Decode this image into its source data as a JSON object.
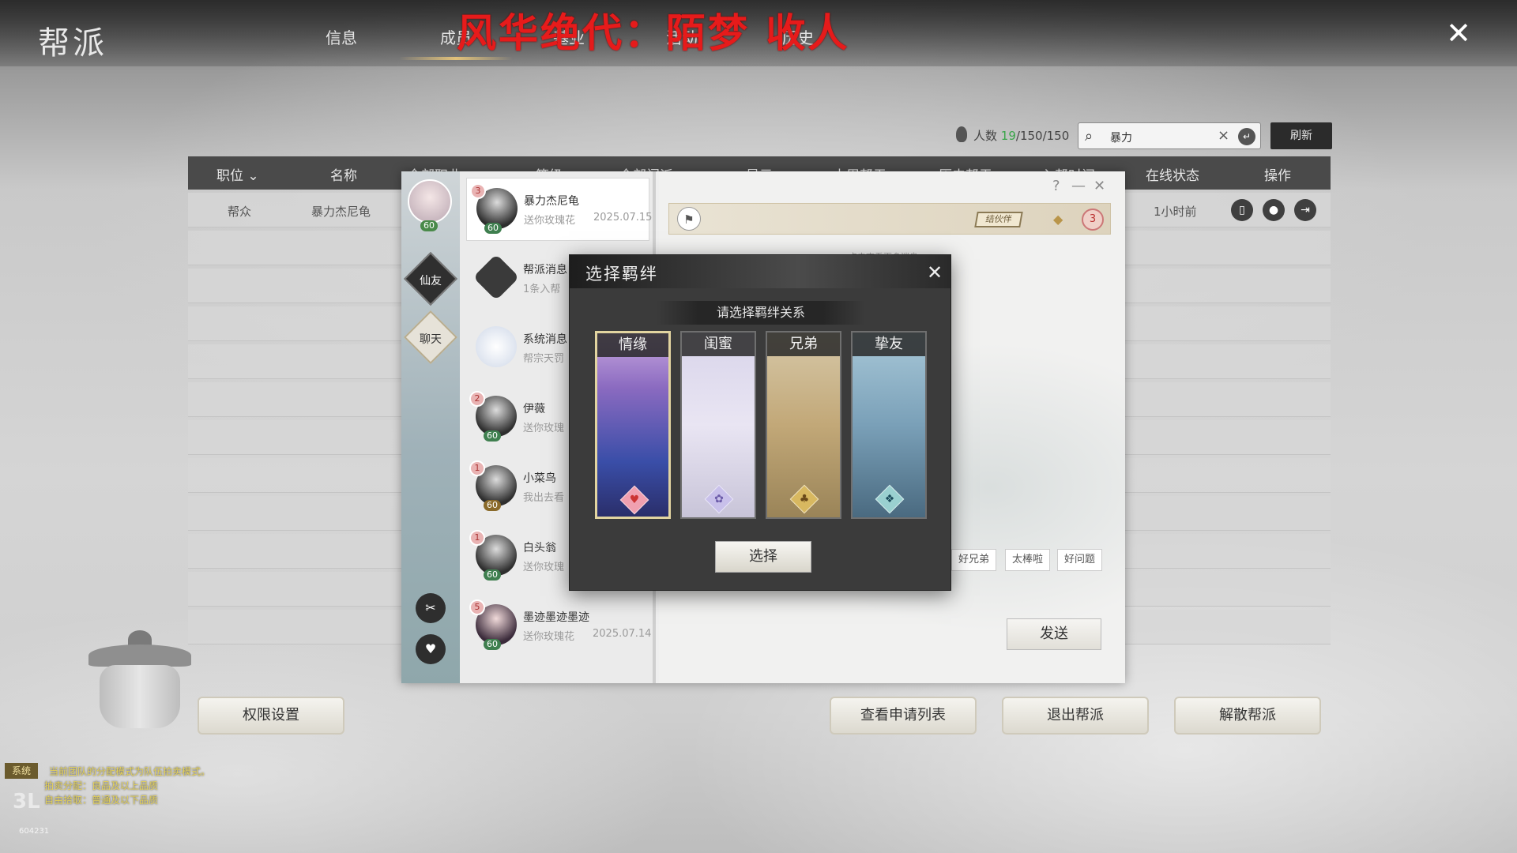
{
  "top": {
    "title": "帮派",
    "tabs": [
      "信息",
      "成员",
      "基业",
      "活动",
      "历史"
    ],
    "active_tab": "成员",
    "stream_title": "风华绝代：陌梦 收人"
  },
  "toolbar": {
    "count_label": "人数",
    "count_current": "19",
    "count_rest": "/150/150",
    "search_value": "暴力",
    "refresh_label": "刷新"
  },
  "table": {
    "headers": [
      "职位",
      "名称",
      "全部职业",
      "等级",
      "全部门派",
      "星元",
      "本周帮贡",
      "历史帮贡",
      "入帮时间",
      "在线状态",
      "操作"
    ],
    "rows": [
      {
        "position": "帮众",
        "name": "暴力杰尼龟",
        "online": "1小时前"
      }
    ]
  },
  "chat": {
    "self_level": "60",
    "side_buttons": [
      "仙友",
      "聊天"
    ],
    "contacts": [
      {
        "name": "暴力杰尼龟",
        "sub": "送你玫瑰花",
        "date": "2025.07.15",
        "badge": "3",
        "level": "60"
      },
      {
        "name": "帮派消息",
        "sub": "1条入帮",
        "date": "",
        "badge": "",
        "level": ""
      },
      {
        "name": "系统消息",
        "sub": "帮宗天罚",
        "date": "",
        "badge": "",
        "level": ""
      },
      {
        "name": "伊薇",
        "sub": "送你玫瑰",
        "date": "",
        "badge": "2",
        "level": "60"
      },
      {
        "name": "小菜鸟",
        "sub": "我出去看",
        "date": "",
        "badge": "1",
        "level": "60"
      },
      {
        "name": "白头翁",
        "sub": "送你玫瑰",
        "date": "",
        "badge": "1",
        "level": "60"
      },
      {
        "name": "墨迹墨迹墨迹",
        "sub": "送你玫瑰花",
        "date": "2025.07.14",
        "badge": "5",
        "level": "60"
      }
    ],
    "partner_tag": "结伙伴",
    "notif_count": "3",
    "more_hint": "点击查看更多消息",
    "quick_replies": [
      "好兄弟",
      "太棒啦",
      "好问题"
    ],
    "send_label": "发送"
  },
  "bond_dialog": {
    "title": "选择羁绊",
    "subtitle": "请选择羁绊关系",
    "options": [
      "情缘",
      "闺蜜",
      "兄弟",
      "挚友"
    ],
    "selected": "情缘",
    "select_label": "选择"
  },
  "bottom_buttons": {
    "permissions": "权限设置",
    "applications": "查看申请列表",
    "leave": "退出帮派",
    "disband": "解散帮派"
  },
  "system_log": {
    "tag": "系统",
    "lines": [
      "当前团队的分配模式为队伍拍卖模式。",
      "拍卖分配：良品及以上品质",
      "自由拾取：普通及以下品质"
    ]
  },
  "watermark": {
    "text": "3L",
    "number": "604231"
  },
  "colors": {
    "accent_gold": "#e2c27a",
    "stream_red": "#e61b1b",
    "online_green": "#3aa54a"
  }
}
